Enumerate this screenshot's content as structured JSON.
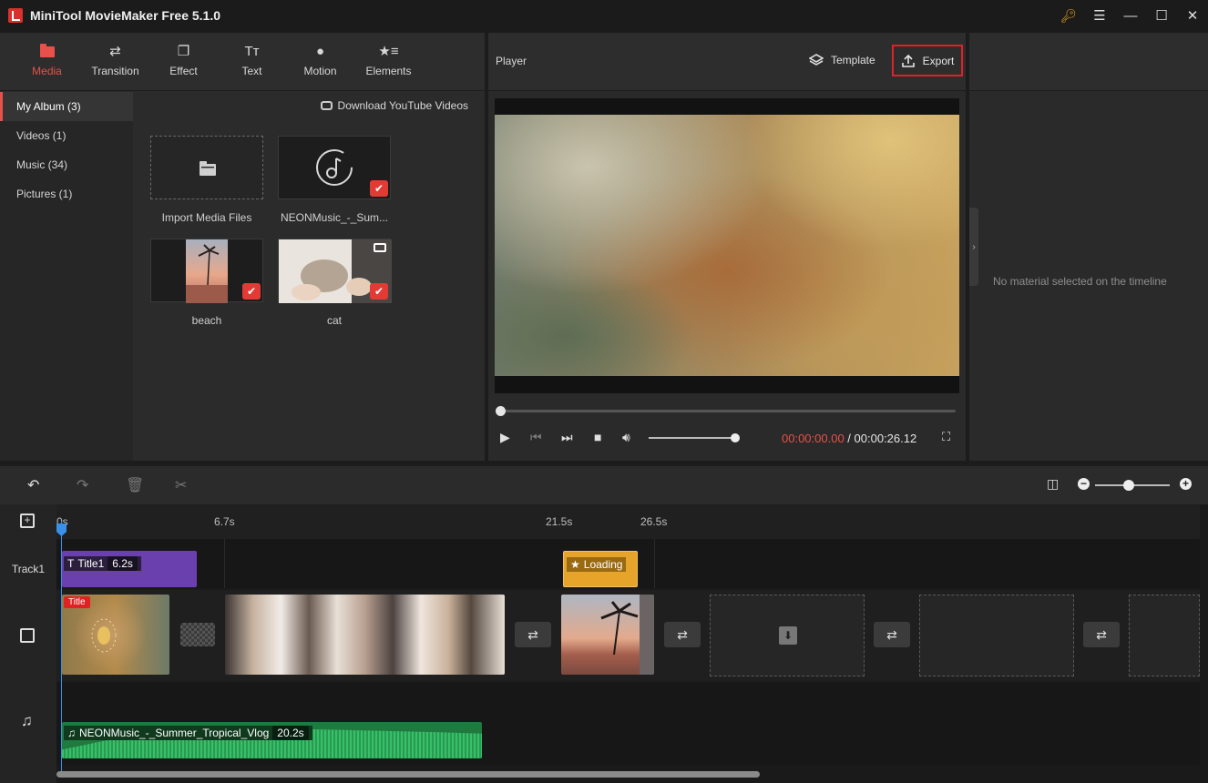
{
  "app": {
    "title": "MiniTool MovieMaker Free 5.1.0"
  },
  "window_controls": [
    "key-icon",
    "menu-icon",
    "minimize-icon",
    "maximize-icon",
    "close-icon"
  ],
  "toolbar": [
    {
      "label": "Media",
      "icon": "folder-icon",
      "active": true
    },
    {
      "label": "Transition",
      "icon": "transition-icon"
    },
    {
      "label": "Effect",
      "icon": "effect-icon"
    },
    {
      "label": "Text",
      "icon": "text-icon"
    },
    {
      "label": "Motion",
      "icon": "motion-icon"
    },
    {
      "label": "Elements",
      "icon": "elements-icon"
    }
  ],
  "albums": [
    {
      "label": "My Album (3)",
      "active": true
    },
    {
      "label": "Videos (1)"
    },
    {
      "label": "Music (34)"
    },
    {
      "label": "Pictures (1)"
    }
  ],
  "media": {
    "download_label": "Download YouTube Videos",
    "items": [
      {
        "label": "Import Media Files"
      },
      {
        "label": "NEONMusic_-_Sum..."
      },
      {
        "label": "beach"
      },
      {
        "label": "cat"
      }
    ]
  },
  "player": {
    "title": "Player",
    "template_label": "Template",
    "export_label": "Export",
    "time_current": "00:00:00.00",
    "time_separator": " / ",
    "time_total": "00:00:26.12",
    "seek_progress": 0,
    "volume_level": 1.0
  },
  "properties": {
    "empty_message": "No material selected on the timeline"
  },
  "timeline": {
    "ruler_ticks": [
      "0s",
      "6.7s",
      "21.5s",
      "26.5s"
    ],
    "track_label": "Track1",
    "title_clip": {
      "label": "Title1",
      "duration": "6.2s"
    },
    "element_clip": {
      "label": "Loading"
    },
    "title_badge": "Title",
    "audio_clip": {
      "label": "NEONMusic_-_Summer_Tropical_Vlog",
      "duration": "20.2s"
    },
    "zoom_level": 0.45
  },
  "colors": {
    "accent": "#e8504a",
    "export_border": "#e0202a",
    "title_clip": "#6a3fae",
    "element_clip": "#e6a52a",
    "audio_clip": "#2fae5c",
    "playhead": "#3a8fe8"
  }
}
